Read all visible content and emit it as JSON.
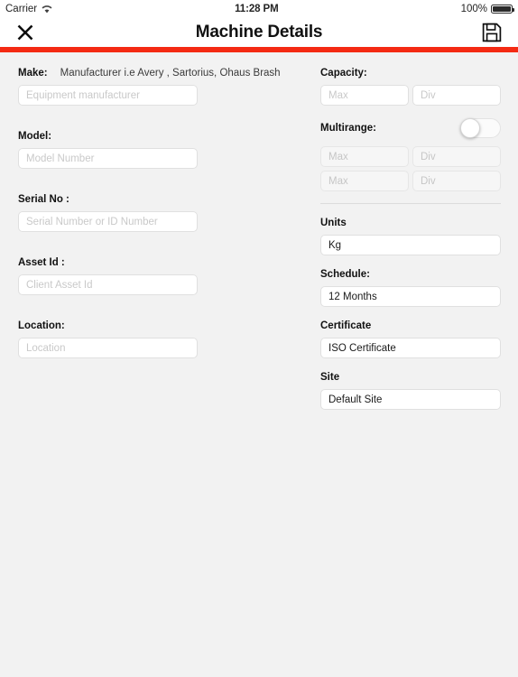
{
  "statusbar": {
    "carrier": "Carrier",
    "wifi_icon": "wifi-icon",
    "time": "11:28 PM",
    "battery_percent": "100%",
    "battery_icon": "battery-full-icon"
  },
  "navbar": {
    "title": "Machine Details",
    "close_icon": "close-x-icon",
    "save_icon": "floppy-disk-save-icon",
    "accent_color": "#f42a13"
  },
  "left_column": {
    "make": {
      "label": "Make:",
      "hint": "Manufacturer i.e Avery , Sartorius, Ohaus Brash",
      "placeholder": "Equipment manufacturer",
      "value": ""
    },
    "model": {
      "label": "Model:",
      "placeholder": "Model Number",
      "value": ""
    },
    "serial_no": {
      "label": "Serial No :",
      "placeholder": "Serial Number or ID Number",
      "value": ""
    },
    "asset_id": {
      "label": "Asset Id :",
      "placeholder": "Client Asset Id",
      "value": ""
    },
    "location": {
      "label": "Location:",
      "placeholder": "Location",
      "value": ""
    }
  },
  "right_column": {
    "capacity": {
      "label": "Capacity:",
      "max_placeholder": "Max",
      "max_value": "",
      "div_placeholder": "Div",
      "div_value": ""
    },
    "multirange": {
      "label": "Multirange:",
      "enabled": false,
      "rows": [
        {
          "max_placeholder": "Max",
          "max_value": "",
          "div_placeholder": "Div",
          "div_value": ""
        },
        {
          "max_placeholder": "Max",
          "max_value": "",
          "div_placeholder": "Div",
          "div_value": ""
        }
      ]
    },
    "units": {
      "label": "Units",
      "value": "Kg"
    },
    "schedule": {
      "label": "Schedule:",
      "value": "12 Months"
    },
    "certificate": {
      "label": "Certificate",
      "value": "ISO Certificate"
    },
    "site": {
      "label": "Site",
      "value": "Default Site"
    }
  }
}
